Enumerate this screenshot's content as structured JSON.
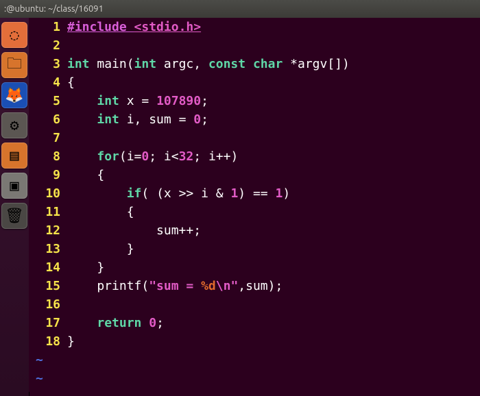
{
  "titlebar": ":@ubuntu: ~/class/16091",
  "launcher": [
    {
      "name": "dash-icon",
      "glyph": "◌",
      "bg": "#e36e3a"
    },
    {
      "name": "home-folder-icon",
      "glyph": "🗀",
      "bg": "#d7742c"
    },
    {
      "name": "firefox-icon",
      "glyph": "🦊",
      "bg": "#1a4fb4"
    },
    {
      "name": "settings-icon",
      "glyph": "⚙",
      "bg": "#5b5652"
    },
    {
      "name": "files-icon",
      "glyph": "▤",
      "bg": "#d7742c"
    },
    {
      "name": "window-icon",
      "glyph": "▣",
      "bg": "#7a7874"
    },
    {
      "name": "trash-icon",
      "glyph": "🗑",
      "bg": "#4a4744"
    }
  ],
  "code": {
    "lines": [
      [
        {
          "t": "#include ",
          "c": "pp ul"
        },
        {
          "t": "<stdio.h>",
          "c": "hdr ul"
        }
      ],
      [],
      [
        {
          "t": "int",
          "c": "kw"
        },
        {
          "t": " main(",
          "c": "id"
        },
        {
          "t": "int",
          "c": "kw"
        },
        {
          "t": " argc, ",
          "c": "id"
        },
        {
          "t": "const",
          "c": "kw"
        },
        {
          "t": " ",
          "c": "id"
        },
        {
          "t": "char",
          "c": "kw"
        },
        {
          "t": " *argv[])",
          "c": "id"
        }
      ],
      [
        {
          "t": "{",
          "c": "id"
        }
      ],
      [
        {
          "t": "    ",
          "c": "id"
        },
        {
          "t": "int",
          "c": "kw"
        },
        {
          "t": " x = ",
          "c": "id"
        },
        {
          "t": "107890",
          "c": "num"
        },
        {
          "t": ";",
          "c": "id"
        }
      ],
      [
        {
          "t": "    ",
          "c": "id"
        },
        {
          "t": "int",
          "c": "kw"
        },
        {
          "t": " i, sum = ",
          "c": "id"
        },
        {
          "t": "0",
          "c": "num"
        },
        {
          "t": ";",
          "c": "id"
        }
      ],
      [],
      [
        {
          "t": "    ",
          "c": "id"
        },
        {
          "t": "for",
          "c": "kw"
        },
        {
          "t": "(i=",
          "c": "id"
        },
        {
          "t": "0",
          "c": "num"
        },
        {
          "t": "; i<",
          "c": "id"
        },
        {
          "t": "32",
          "c": "num"
        },
        {
          "t": "; i++)",
          "c": "id"
        }
      ],
      [
        {
          "t": "    {",
          "c": "id"
        }
      ],
      [
        {
          "t": "        ",
          "c": "id"
        },
        {
          "t": "if",
          "c": "kw"
        },
        {
          "t": "( (x >> i & ",
          "c": "id"
        },
        {
          "t": "1",
          "c": "num"
        },
        {
          "t": ") == ",
          "c": "id"
        },
        {
          "t": "1",
          "c": "num"
        },
        {
          "t": ")",
          "c": "id"
        }
      ],
      [
        {
          "t": "        {",
          "c": "id"
        }
      ],
      [
        {
          "t": "            sum++;",
          "c": "id"
        }
      ],
      [
        {
          "t": "        }",
          "c": "id"
        }
      ],
      [
        {
          "t": "    }",
          "c": "id"
        }
      ],
      [
        {
          "t": "    printf(",
          "c": "id"
        },
        {
          "t": "\"sum = ",
          "c": "str"
        },
        {
          "t": "%d",
          "c": "fmt"
        },
        {
          "t": "\\n",
          "c": "str"
        },
        {
          "t": "\"",
          "c": "str"
        },
        {
          "t": ",sum);",
          "c": "id"
        }
      ],
      [],
      [
        {
          "t": "    ",
          "c": "id"
        },
        {
          "t": "return",
          "c": "kw"
        },
        {
          "t": " ",
          "c": "id"
        },
        {
          "t": "0",
          "c": "num"
        },
        {
          "t": ";",
          "c": "id"
        }
      ],
      [
        {
          "t": "}",
          "c": "id"
        }
      ]
    ],
    "tilde": "~"
  }
}
